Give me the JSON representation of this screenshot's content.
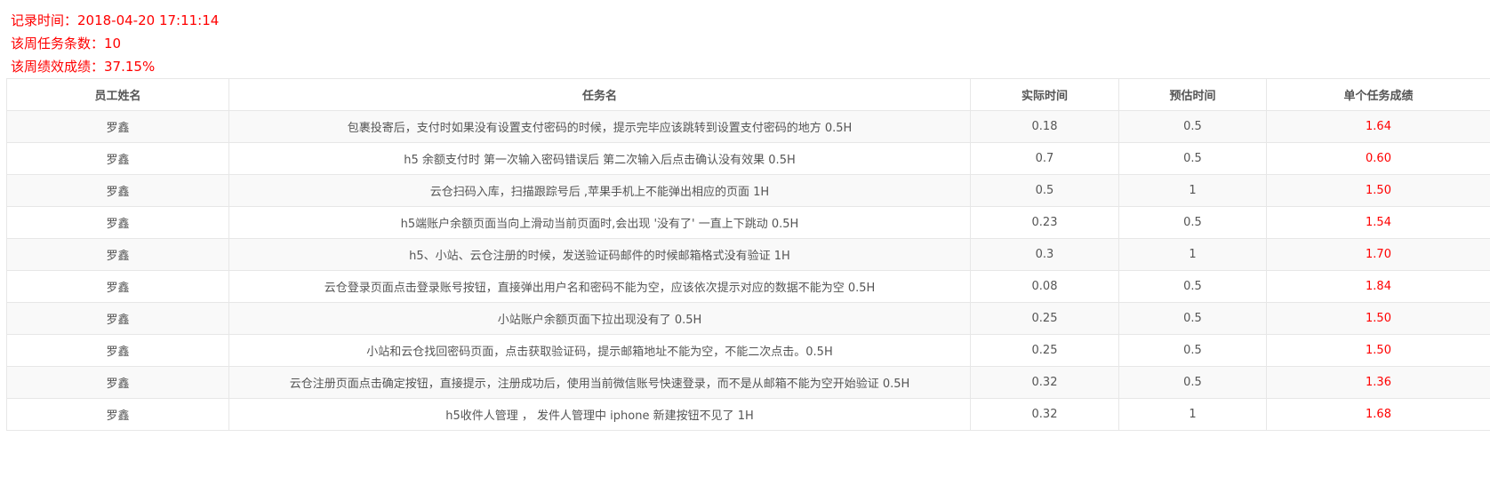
{
  "summary": {
    "record_time": "记录时间：2018-04-20 17:11:14",
    "task_count": "该周任务条数：10",
    "performance": "该周绩效成绩：37.15%"
  },
  "table": {
    "headers": {
      "name": "员工姓名",
      "task": "任务名",
      "actual": "实际时间",
      "estimated": "预估时间",
      "score": "单个任务成绩"
    },
    "rows": [
      {
        "name": "罗鑫",
        "task": "包裹投寄后，支付时如果没有设置支付密码的时候，提示完毕应该跳转到设置支付密码的地方 0.5H",
        "actual": "0.18",
        "estimated": "0.5",
        "score": "1.64"
      },
      {
        "name": "罗鑫",
        "task": "h5 余额支付时 第一次输入密码错误后 第二次输入后点击确认没有效果 0.5H",
        "actual": "0.7",
        "estimated": "0.5",
        "score": "0.60"
      },
      {
        "name": "罗鑫",
        "task": "云仓扫码入库，扫描跟踪号后 ,苹果手机上不能弹出相应的页面 1H",
        "actual": "0.5",
        "estimated": "1",
        "score": "1.50"
      },
      {
        "name": "罗鑫",
        "task": "h5端账户余额页面当向上滑动当前页面时,会出现 '没有了' 一直上下跳动 0.5H",
        "actual": "0.23",
        "estimated": "0.5",
        "score": "1.54"
      },
      {
        "name": "罗鑫",
        "task": "h5、小站、云仓注册的时候，发送验证码邮件的时候邮箱格式没有验证 1H",
        "actual": "0.3",
        "estimated": "1",
        "score": "1.70"
      },
      {
        "name": "罗鑫",
        "task": "云仓登录页面点击登录账号按钮，直接弹出用户名和密码不能为空，应该依次提示对应的数据不能为空 0.5H",
        "actual": "0.08",
        "estimated": "0.5",
        "score": "1.84"
      },
      {
        "name": "罗鑫",
        "task": "小站账户余额页面下拉出现没有了 0.5H",
        "actual": "0.25",
        "estimated": "0.5",
        "score": "1.50"
      },
      {
        "name": "罗鑫",
        "task": "小站和云仓找回密码页面，点击获取验证码，提示邮箱地址不能为空，不能二次点击。0.5H",
        "actual": "0.25",
        "estimated": "0.5",
        "score": "1.50"
      },
      {
        "name": "罗鑫",
        "task": "云仓注册页面点击确定按钮，直接提示，注册成功后，使用当前微信账号快速登录，而不是从邮箱不能为空开始验证 0.5H",
        "actual": "0.32",
        "estimated": "0.5",
        "score": "1.36"
      },
      {
        "name": "罗鑫",
        "task": "h5收件人管理 ， 发件人管理中 iphone 新建按钮不见了 1H",
        "actual": "0.32",
        "estimated": "1",
        "score": "1.68"
      }
    ]
  },
  "colors": {
    "highlight": "#ff0000",
    "text": "#555555",
    "border": "#e7e7e7",
    "stripe": "#f9f9f9"
  }
}
